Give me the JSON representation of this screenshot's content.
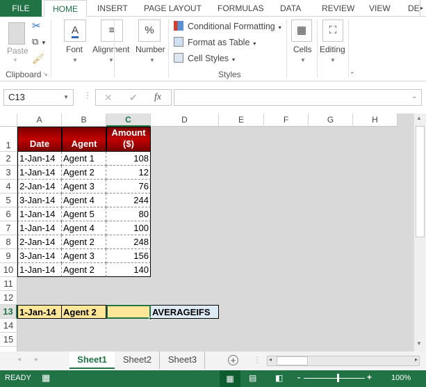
{
  "ribbon_tabs": [
    "FILE",
    "HOME",
    "INSERT",
    "PAGE LAYOUT",
    "FORMULAS",
    "DATA",
    "REVIEW",
    "VIEW",
    "DE"
  ],
  "ribbon": {
    "clipboard": {
      "paste": "Paste",
      "group": "Clipboard"
    },
    "font": "Font",
    "alignment": "Alignment",
    "number": "Number",
    "styles": {
      "conditional": "Conditional Formatting",
      "format_table": "Format as Table",
      "cell_styles": "Cell Styles",
      "group": "Styles"
    },
    "cells": "Cells",
    "editing": "Editing"
  },
  "formula_bar": {
    "name_box": "C13",
    "fx": "fx",
    "formula": ""
  },
  "columns": [
    "A",
    "B",
    "C",
    "D",
    "E",
    "F",
    "G",
    "H"
  ],
  "rows": [
    "1",
    "2",
    "3",
    "4",
    "5",
    "6",
    "7",
    "8",
    "9",
    "10",
    "11",
    "12",
    "13",
    "14",
    "15"
  ],
  "table": {
    "headers": [
      "Date",
      "Agent",
      "Amount ($)"
    ],
    "rows": [
      [
        "1-Jan-14",
        "Agent 1",
        "108"
      ],
      [
        "1-Jan-14",
        "Agent 2",
        "12"
      ],
      [
        "2-Jan-14",
        "Agent 3",
        "76"
      ],
      [
        "3-Jan-14",
        "Agent 4",
        "244"
      ],
      [
        "1-Jan-14",
        "Agent 5",
        "80"
      ],
      [
        "1-Jan-14",
        "Agent 4",
        "100"
      ],
      [
        "2-Jan-14",
        "Agent 2",
        "248"
      ],
      [
        "3-Jan-14",
        "Agent 3",
        "156"
      ],
      [
        "1-Jan-14",
        "Agent 2",
        "140"
      ]
    ]
  },
  "criteria_row": {
    "date": "1-Jan-14",
    "agent": "Agent 2",
    "result": "",
    "label": "AVERAGEIFS"
  },
  "sheets": [
    "Sheet1",
    "Sheet2",
    "Sheet3"
  ],
  "active_sheet": "Sheet1",
  "status": {
    "mode": "READY",
    "zoom": "100%"
  },
  "colors": {
    "accent": "#217346",
    "header_red": "#c00000",
    "criteria_fill": "#ffe699",
    "label_fill": "#ddebf7",
    "sheet_bg": "#d9d9d9"
  }
}
